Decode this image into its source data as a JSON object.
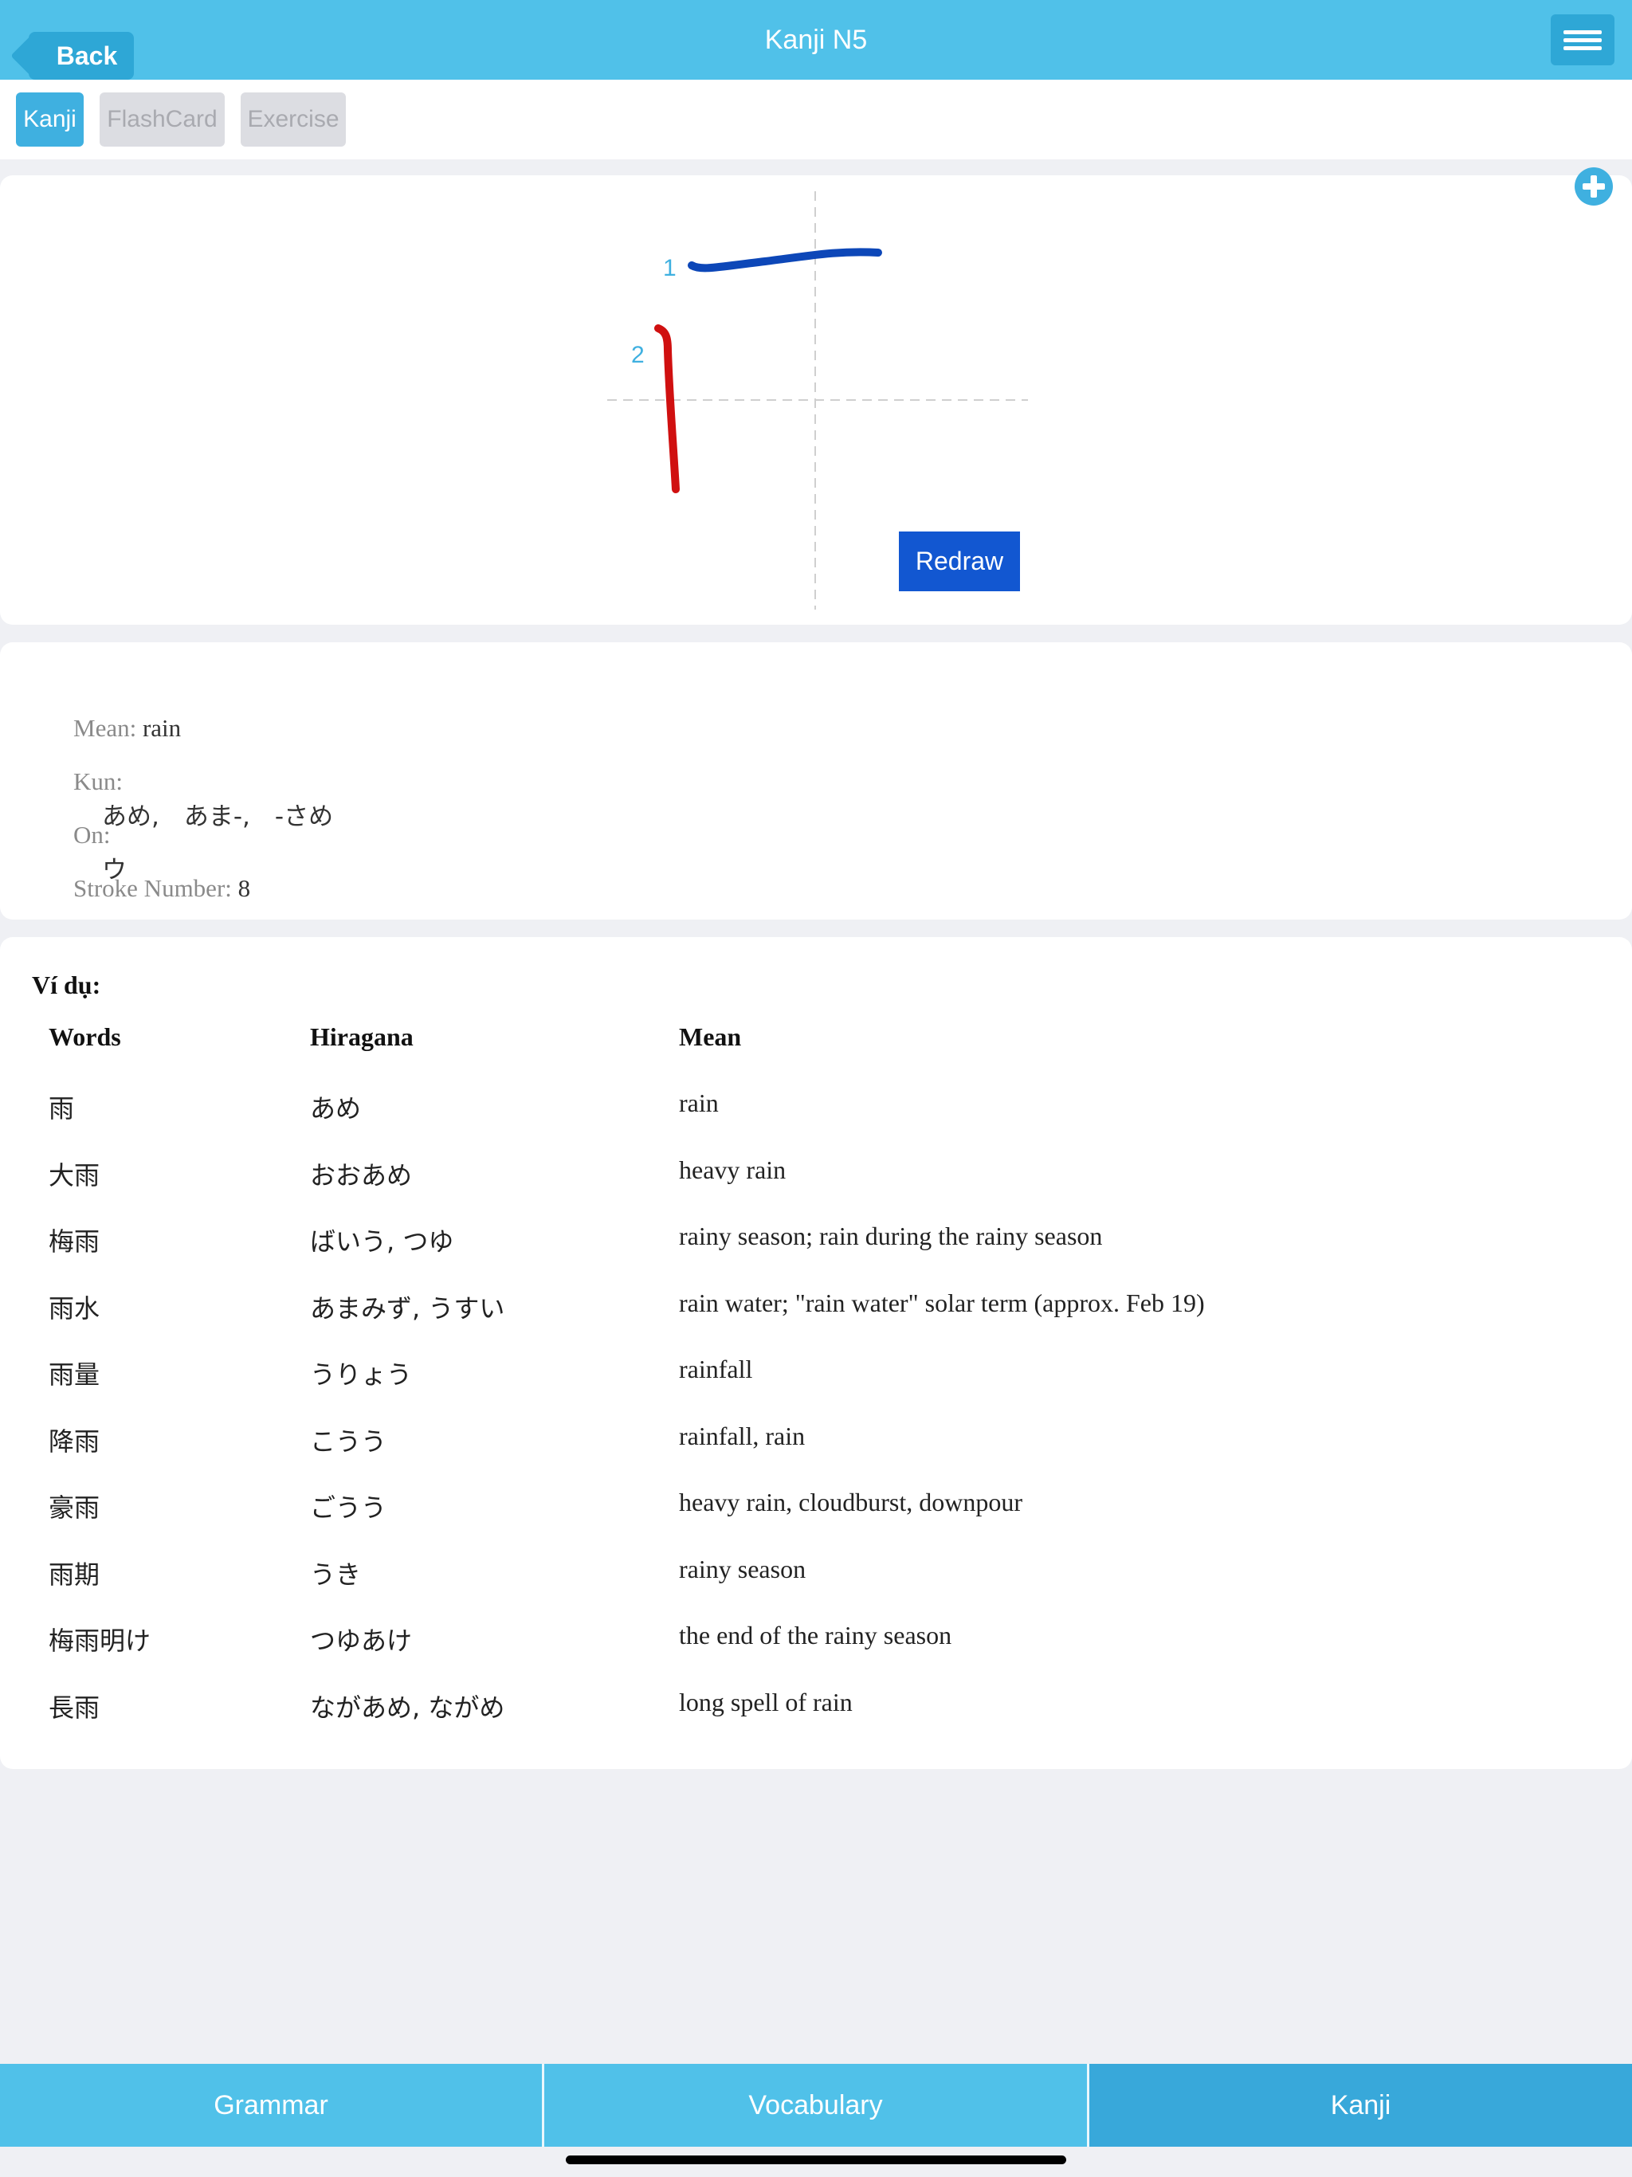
{
  "header": {
    "back_label": "Back",
    "title": "Kanji N5"
  },
  "tabs": [
    {
      "label": "Kanji",
      "active": true
    },
    {
      "label": "FlashCard",
      "active": false
    },
    {
      "label": "Exercise",
      "active": false
    }
  ],
  "stroke_panel": {
    "stroke_numbers": [
      "1",
      "2"
    ],
    "stroke_colors": [
      "#0d47b8",
      "#d01010"
    ],
    "redraw_label": "Redraw"
  },
  "info": {
    "mean_label": "Mean:",
    "mean_value": " rain",
    "kun_label": "Kun:",
    "kun_value": "あめ,　あま-,　-さめ",
    "on_label": "On:",
    "on_value": "ウ",
    "stroke_label": "Stroke Number:",
    "stroke_value": " 8"
  },
  "examples": {
    "title": "Ví dụ:",
    "headers": [
      "Words",
      "Hiragana",
      "Mean"
    ],
    "rows": [
      [
        "雨",
        "あめ",
        "rain"
      ],
      [
        "大雨",
        "おおあめ",
        "heavy rain"
      ],
      [
        "梅雨",
        "ばいう, つゆ",
        "rainy season; rain during the rainy season"
      ],
      [
        "雨水",
        "あまみず, うすい",
        "rain water; \"rain water\" solar term (approx. Feb 19)"
      ],
      [
        "雨量",
        "うりょう",
        "rainfall"
      ],
      [
        "降雨",
        "こうう",
        "rainfall, rain"
      ],
      [
        "豪雨",
        "ごうう",
        "heavy rain, cloudburst, downpour"
      ],
      [
        "雨期",
        "うき",
        "rainy season"
      ],
      [
        "梅雨明け",
        "つゆあけ",
        "the end of the rainy season"
      ],
      [
        "長雨",
        "ながあめ, ながめ",
        "long spell of rain"
      ]
    ]
  },
  "bottom_tabs": [
    {
      "label": "Grammar",
      "active": false
    },
    {
      "label": "Vocabulary",
      "active": false
    },
    {
      "label": "Kanji",
      "active": true
    }
  ],
  "colors": {
    "accent": "#50c1e9",
    "active_tab": "#3fb0e0",
    "redraw": "#1257d1"
  }
}
